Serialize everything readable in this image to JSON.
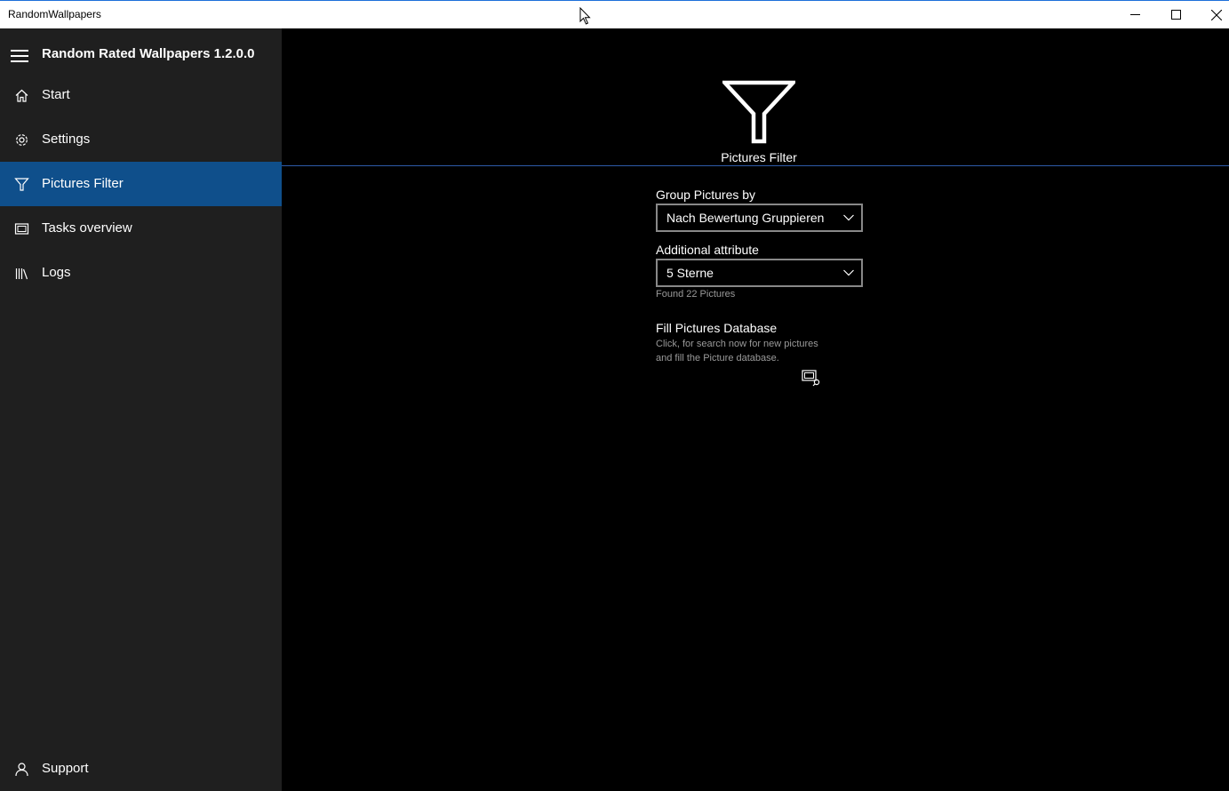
{
  "window": {
    "title": "RandomWallpapers",
    "controls": [
      "minimize-icon",
      "maximize-icon",
      "close-icon"
    ]
  },
  "app": {
    "title": "Random Rated Wallpapers 1.2.0.0"
  },
  "sidebar": {
    "items": [
      {
        "label": "Start",
        "icon": "home-icon",
        "active": false
      },
      {
        "label": "Settings",
        "icon": "gear-icon",
        "active": false
      },
      {
        "label": "Pictures Filter",
        "icon": "filter-icon",
        "active": true
      },
      {
        "label": "Tasks overview",
        "icon": "tasks-icon",
        "active": false
      },
      {
        "label": "Logs",
        "icon": "library-icon",
        "active": false
      }
    ],
    "footer": {
      "label": "Support",
      "icon": "person-icon"
    }
  },
  "main": {
    "header_icon": "filter-icon",
    "page_title": "Pictures Filter",
    "group_by": {
      "label": "Group Pictures by",
      "value": "Nach Bewertung Gruppieren"
    },
    "attribute": {
      "label": "Additional attribute",
      "value": "5 Sterne"
    },
    "found_text": "Found 22 Pictures",
    "fill_db": {
      "title": "Fill Pictures Database",
      "description_line1": "Click, for search now for new pictures",
      "description_line2": "and fill the Picture database.",
      "button_icon": "search-pictures-icon"
    }
  },
  "colors": {
    "accent": "#0f4f8b",
    "sidebar_bg": "#1f1f1f",
    "main_bg": "#000000",
    "header_line": "#2e5aa8"
  }
}
